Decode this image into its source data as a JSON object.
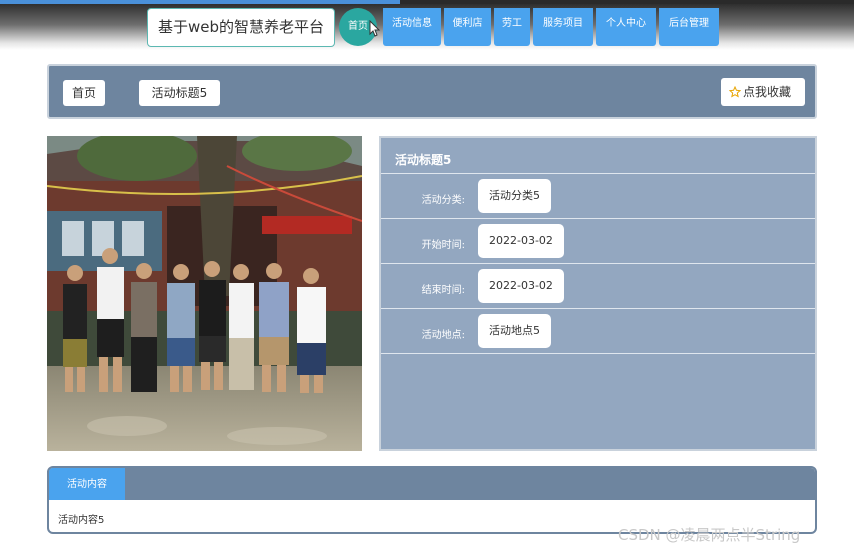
{
  "header": {
    "site_title": "基于web的智慧养老平台",
    "nav": [
      {
        "label": "首页"
      },
      {
        "label": "活动信息"
      },
      {
        "label": "便利店"
      },
      {
        "label": "劳工"
      },
      {
        "label": "服务项目"
      },
      {
        "label": "个人中心"
      },
      {
        "label": "后台管理"
      }
    ]
  },
  "breadcrumb": {
    "home": "首页",
    "current": "活动标题5",
    "favorite": "点我收藏"
  },
  "details": {
    "title": "活动标题5",
    "rows": [
      {
        "label": "活动分类:",
        "value": "活动分类5"
      },
      {
        "label": "开始时间:",
        "value": "2022-03-02"
      },
      {
        "label": "结束时间:",
        "value": "2022-03-02"
      },
      {
        "label": "活动地点:",
        "value": "活动地点5"
      }
    ]
  },
  "content": {
    "tab_label": "活动内容",
    "text": "活动内容5"
  },
  "watermark": "CSDN @凌晨两点半String",
  "colors": {
    "nav_blue": "#4aa3ee",
    "teal": "#2aa7a0",
    "panel_slate": "#6e859f",
    "panel_light": "#93a7c0"
  }
}
